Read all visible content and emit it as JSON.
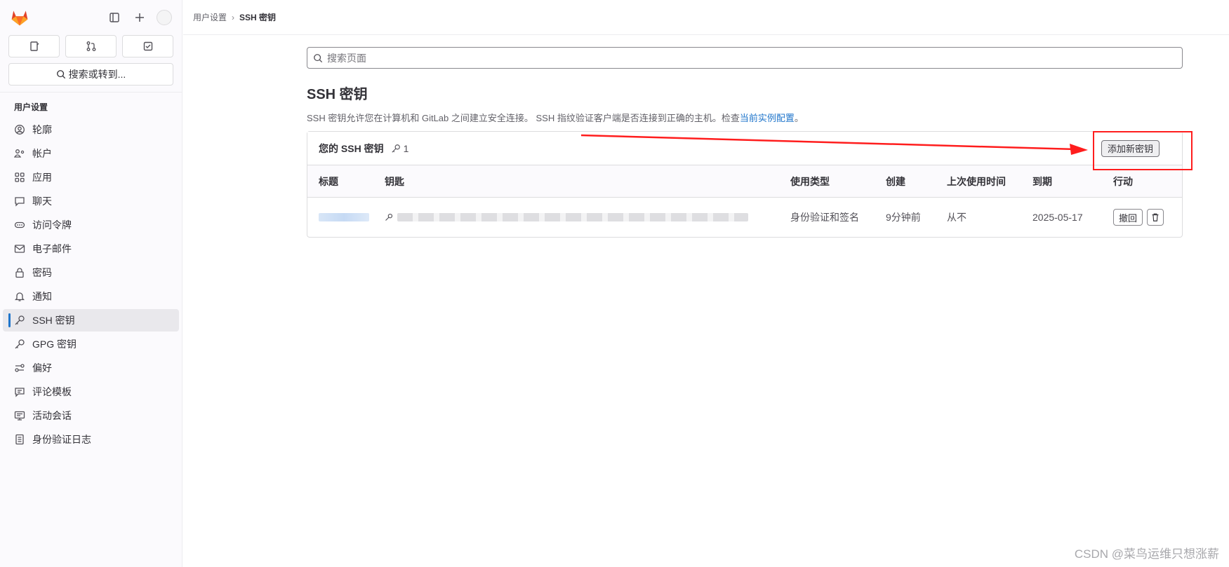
{
  "sidebar": {
    "tabs": [
      "issues-icon",
      "merge-requests-icon",
      "todo-icon"
    ],
    "search_label": "搜索或转到...",
    "section_title": "用户设置",
    "items": [
      {
        "label": "轮廓",
        "icon": "profile-icon"
      },
      {
        "label": "帐户",
        "icon": "account-icon"
      },
      {
        "label": "应用",
        "icon": "applications-icon"
      },
      {
        "label": "聊天",
        "icon": "chat-icon"
      },
      {
        "label": "访问令牌",
        "icon": "token-icon"
      },
      {
        "label": "电子邮件",
        "icon": "mail-icon"
      },
      {
        "label": "密码",
        "icon": "lock-icon"
      },
      {
        "label": "通知",
        "icon": "bell-icon"
      },
      {
        "label": "SSH 密钥",
        "icon": "key-icon",
        "active": true
      },
      {
        "label": "GPG 密钥",
        "icon": "key-icon"
      },
      {
        "label": "偏好",
        "icon": "preferences-icon"
      },
      {
        "label": "评论模板",
        "icon": "comment-icon"
      },
      {
        "label": "活动会话",
        "icon": "monitor-icon"
      },
      {
        "label": "身份验证日志",
        "icon": "log-icon"
      }
    ]
  },
  "breadcrumb": {
    "parent": "用户设置",
    "current": "SSH 密钥"
  },
  "page": {
    "search_placeholder": "搜索页面",
    "title": "SSH 密钥",
    "description": "SSH 密钥允许您在计算机和 GitLab 之间建立安全连接。 SSH 指纹验证客户端是否连接到正确的主机。检查",
    "description_link": "当前实例配置",
    "description_end": "。"
  },
  "card": {
    "title": "您的 SSH 密钥",
    "count": "1",
    "add_button": "添加新密钥",
    "columns": [
      "标题",
      "钥匙",
      "使用类型",
      "创建",
      "上次使用时间",
      "到期",
      "行动"
    ],
    "rows": [
      {
        "usage": "身份验证和签名",
        "created": "9分钟前",
        "last_used": "从不",
        "expires": "2025-05-17",
        "revoke": "撤回"
      }
    ]
  },
  "watermark": "CSDN @菜鸟运维只想涨薪",
  "colors": {
    "accent": "#1f75cb",
    "annotation": "#ff1d1d"
  }
}
